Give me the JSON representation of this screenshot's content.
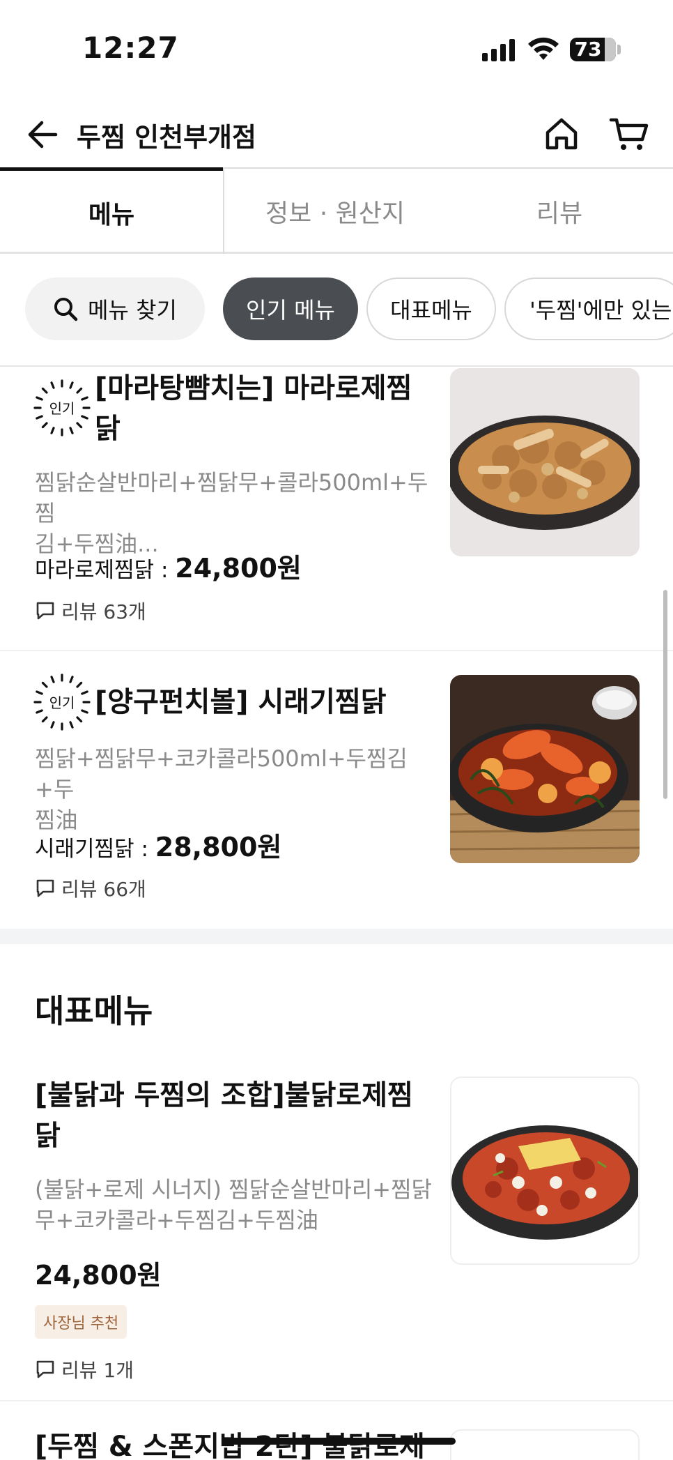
{
  "status_bar": {
    "time": "12:27",
    "battery": "73"
  },
  "header": {
    "store_name": "두찜 인천부개점"
  },
  "tabs": [
    {
      "label": "메뉴",
      "active": true
    },
    {
      "label": "정보 · 원산지",
      "active": false
    },
    {
      "label": "리뷰",
      "active": false
    }
  ],
  "chips": {
    "search": "메뉴 찾기",
    "items": [
      {
        "label": "인기 메뉴",
        "selected": true
      },
      {
        "label": "대표메뉴",
        "selected": false
      },
      {
        "label": "'두찜'에만 있는",
        "selected": false
      }
    ]
  },
  "badge_label": "인기",
  "popular_items": [
    {
      "title_line1": "[마라탕뺨치는] 마라로제찜",
      "title_line2": "닭",
      "desc_line1": "찜닭순살반마리+찜닭무+콜라500ml+두찜",
      "desc_line2": "김+두찜油...",
      "price_label": "마라로제찜닭 : ",
      "price": "24,800원",
      "reviews": "리뷰 63개",
      "image": "mala-rose-jjimdak-photo"
    },
    {
      "title_line1": "[양구펀치볼] 시래기찜닭",
      "desc_line1": "찜닭+찜닭무+코카콜라500ml+두찜김+두",
      "desc_line2": "찜油",
      "price_label": "시래기찜닭 : ",
      "price": "28,800원",
      "reviews": "리뷰 66개",
      "image": "siraegi-jjimdak-photo"
    }
  ],
  "section": {
    "title": "대표메뉴"
  },
  "signature_items": [
    {
      "title_line1": "[불닭과 두찜의 조합]불닭로제찜",
      "title_line2": "닭",
      "desc_line1": "(불닭+로제 시너지) 찜닭순살반마리+찜닭",
      "desc_line2": "무+코카콜라+두찜김+두찜油",
      "price": "24,800원",
      "tag": "사장님 추천",
      "reviews": "리뷰 1개",
      "image": "buldak-rose-jjimdak-photo"
    },
    {
      "title_line1": "[두찜 & 스폰지밥 2탄] 불닭로제"
    }
  ],
  "colors": {
    "accent_dark": "#4a4d51",
    "owner_tag_bg": "#f7eee6",
    "owner_tag_text": "#a0673c"
  }
}
